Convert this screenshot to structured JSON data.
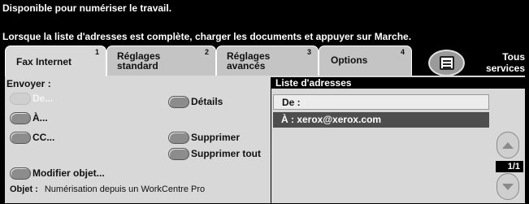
{
  "status": {
    "line1": "Disponible pour numériser le travail.",
    "line2": "Lorsque la liste d'adresses est complète, charger les documents et appuyer sur Marche."
  },
  "tabs": [
    {
      "num": "1",
      "label": "Fax Internet",
      "active": true
    },
    {
      "num": "2",
      "label_line1": "Réglages",
      "label_line2": "standard"
    },
    {
      "num": "3",
      "label_line1": "Réglages",
      "label_line2": "avancés"
    },
    {
      "num": "4",
      "label": "Options"
    }
  ],
  "all_services": {
    "line1": "Tous",
    "line2": "services"
  },
  "left_panel": {
    "send_label": "Envoyer :",
    "from_button": "De...",
    "to_button": "À...",
    "cc_button": "CC...",
    "details_button": "Détails",
    "delete_button": "Supprimer",
    "delete_all_button": "Supprimer tout",
    "modify_object_button": "Modifier objet...",
    "object_label": "Objet :",
    "object_value": "Numérisation depuis un WorkCentre Pro"
  },
  "address_list": {
    "header": "Liste d'adresses",
    "rows": [
      {
        "label": "De :"
      },
      {
        "label": "À : xerox@xerox.com"
      }
    ],
    "page_indicator": "1/1"
  }
}
